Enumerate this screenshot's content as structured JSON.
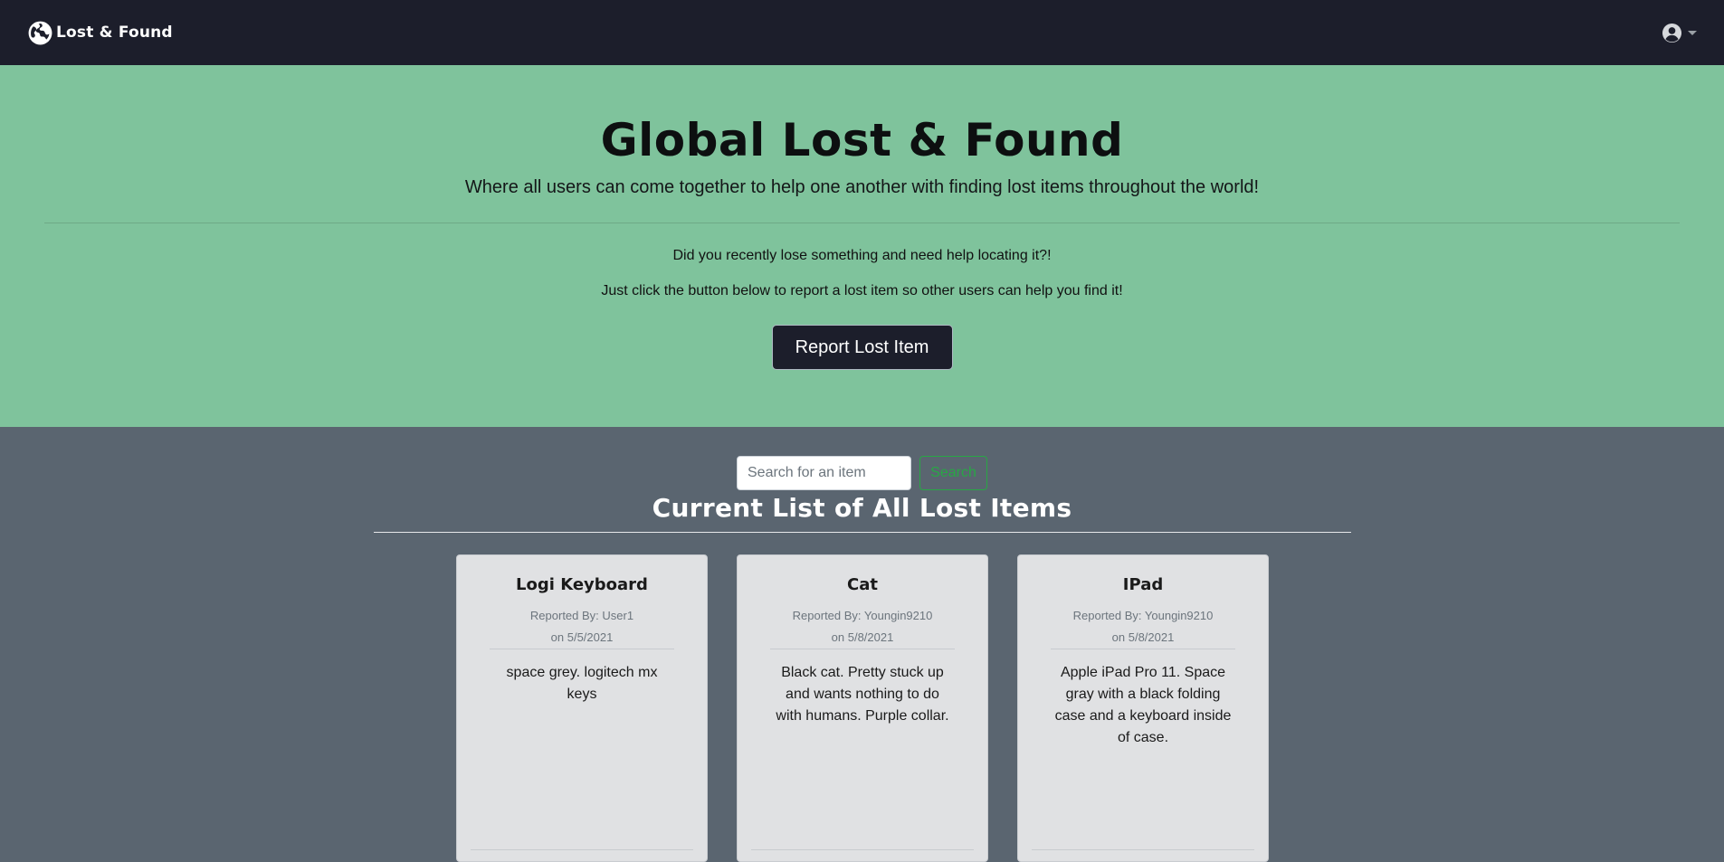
{
  "navbar": {
    "brand": "Lost & Found",
    "brand_icon": "globe-icon",
    "user_icon": "user-circle-icon"
  },
  "hero": {
    "title": "Global Lost & Found",
    "lead": "Where all users can come together to help one another with finding lost items throughout the world!",
    "prompt1": "Did you recently lose something and need help locating it?!",
    "prompt2": "Just click the button below to report a lost item so other users can help you find it!",
    "button": "Report Lost Item"
  },
  "search": {
    "placeholder": "Search for an item",
    "button": "Search"
  },
  "list": {
    "title": "Current List of All Lost Items",
    "items": [
      {
        "title": "Logi Keyboard",
        "reported_by": "Reported By: User1",
        "date": "on 5/5/2021",
        "description": "space grey. logitech mx keys"
      },
      {
        "title": "Cat",
        "reported_by": "Reported By: Youngin9210",
        "date": "on 5/8/2021",
        "description": "Black cat. Pretty stuck up and wants nothing to do with humans. Purple collar."
      },
      {
        "title": "IPad",
        "reported_by": "Reported By: Youngin9210",
        "date": "on 5/8/2021",
        "description": "Apple iPad Pro 11. Space gray with a black folding case and a keyboard inside of case."
      }
    ]
  },
  "colors": {
    "navbar": "#1c1e2b",
    "hero": "#7fc39c",
    "main": "#5a6570",
    "card": "#e0e1e3",
    "search_button": "#28a745"
  }
}
